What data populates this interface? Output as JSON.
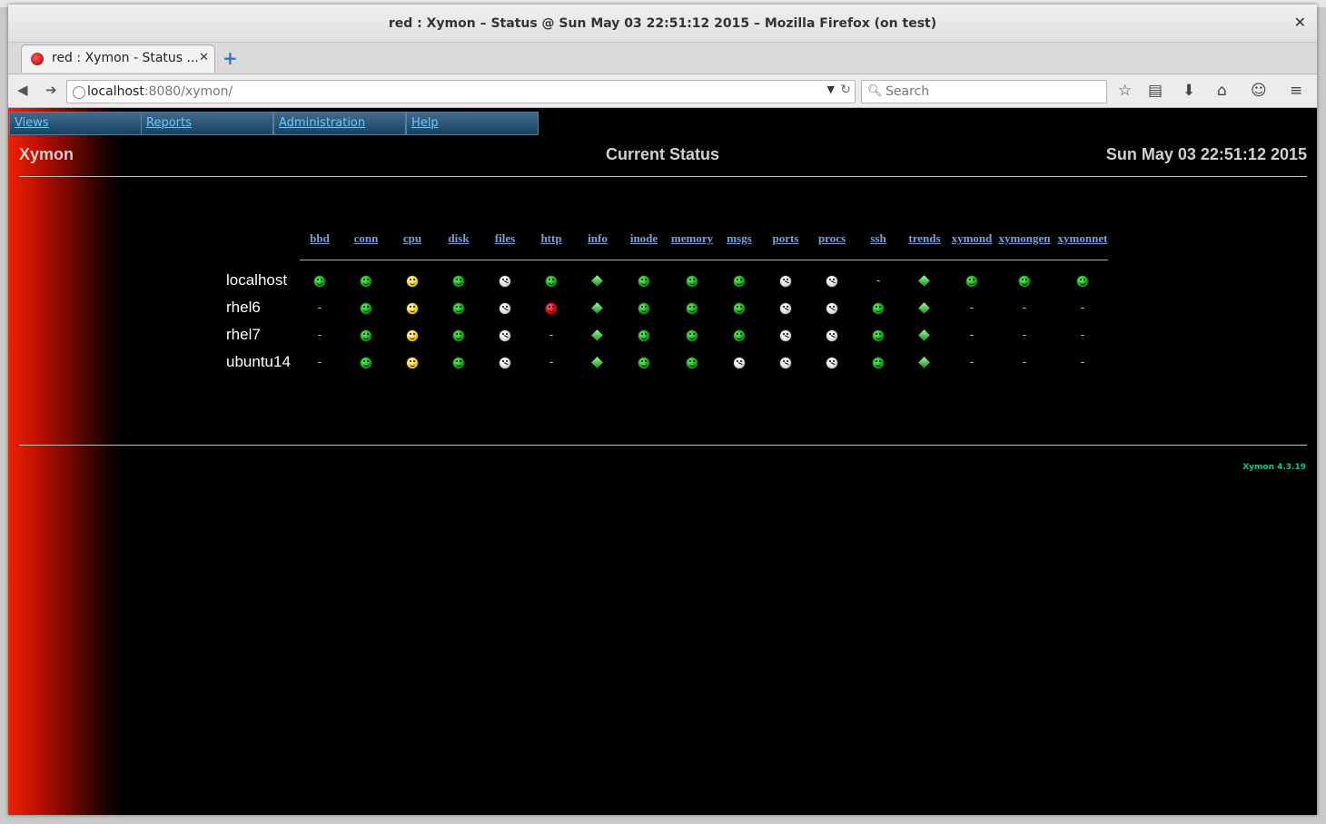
{
  "window": {
    "title": "red : Xymon – Status @ Sun May 03 22:51:12 2015 – Mozilla Firefox (on test)"
  },
  "tab": {
    "label": "red : Xymon - Status ...",
    "favicon": "red-status-icon"
  },
  "toolbar": {
    "url_host": "localhost",
    "url_path": ":8080/xymon/",
    "search_placeholder": "Search"
  },
  "menu": [
    "Views",
    "Reports",
    "Administration",
    "Help"
  ],
  "header": {
    "left": "Xymon",
    "center": "Current Status",
    "right": "Sun May 03 22:51:12 2015"
  },
  "columns": [
    "bbd",
    "conn",
    "cpu",
    "disk",
    "files",
    "http",
    "info",
    "inode",
    "memory",
    "msgs",
    "ports",
    "procs",
    "ssh",
    "trends",
    "xymond",
    "xymongen",
    "xymonnet"
  ],
  "hosts": [
    {
      "name": "localhost",
      "status": [
        "green",
        "green",
        "yellow",
        "green",
        "clear",
        "green",
        "info",
        "green",
        "green",
        "green",
        "clear",
        "clear",
        "none",
        "info",
        "green",
        "green",
        "green"
      ]
    },
    {
      "name": "rhel6",
      "status": [
        "none",
        "green",
        "yellow",
        "green",
        "clear",
        "red",
        "info",
        "green",
        "green",
        "green",
        "clear",
        "clear",
        "green",
        "info",
        "none",
        "none",
        "none"
      ]
    },
    {
      "name": "rhel7",
      "status": [
        "none",
        "green",
        "yellow",
        "green",
        "clear",
        "none",
        "info",
        "green",
        "green",
        "green",
        "clear",
        "clear",
        "green",
        "info",
        "none",
        "none",
        "none"
      ]
    },
    {
      "name": "ubuntu14",
      "status": [
        "none",
        "green",
        "yellow",
        "green",
        "clear",
        "none",
        "info",
        "green",
        "green",
        "clear",
        "clear",
        "clear",
        "green",
        "info",
        "none",
        "none",
        "none"
      ]
    }
  ],
  "footer": {
    "version": "Xymon 4.3.19"
  },
  "colors": {
    "red": "#dd0000",
    "green": "#1a9a1a",
    "yellow": "#ffcc00",
    "clear": "#dddddd",
    "link": "#7aa0d8",
    "menu_link": "#66ccff"
  }
}
